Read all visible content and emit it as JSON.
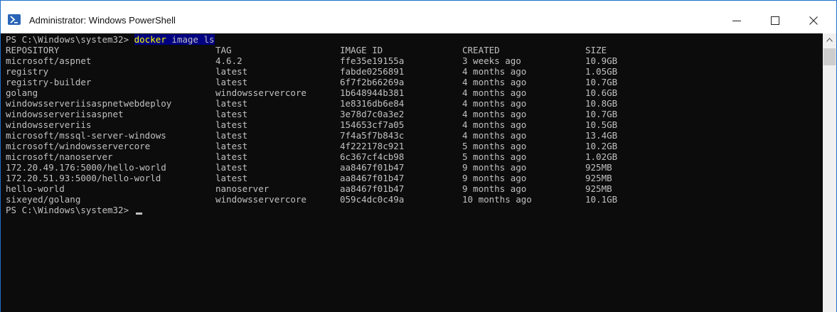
{
  "window": {
    "title": "Administrator: Windows PowerShell"
  },
  "prompt": "PS C:\\Windows\\system32> ",
  "command": {
    "name": "docker",
    "sp1": " ",
    "sub": "image",
    "sp2": " ",
    "arg": "ls"
  },
  "headers": {
    "repository": "REPOSITORY",
    "tag": "TAG",
    "image_id": "IMAGE ID",
    "created": "CREATED",
    "size": "SIZE"
  },
  "rows": [
    {
      "repository": "microsoft/aspnet",
      "tag": "4.6.2",
      "image_id": "ffe35e19155a",
      "created": "3 weeks ago",
      "size": "10.9GB"
    },
    {
      "repository": "registry",
      "tag": "latest",
      "image_id": "fabde0256891",
      "created": "4 months ago",
      "size": "1.05GB"
    },
    {
      "repository": "registry-builder",
      "tag": "latest",
      "image_id": "6f7f2b66269a",
      "created": "4 months ago",
      "size": "10.7GB"
    },
    {
      "repository": "golang",
      "tag": "windowsservercore",
      "image_id": "1b648944b381",
      "created": "4 months ago",
      "size": "10.6GB"
    },
    {
      "repository": "windowsserveriisaspnetwebdeploy",
      "tag": "latest",
      "image_id": "1e8316db6e84",
      "created": "4 months ago",
      "size": "10.8GB"
    },
    {
      "repository": "windowsserveriisaspnet",
      "tag": "latest",
      "image_id": "3e78d7c0a3e2",
      "created": "4 months ago",
      "size": "10.7GB"
    },
    {
      "repository": "windowsserveriis",
      "tag": "latest",
      "image_id": "154653cf7a05",
      "created": "4 months ago",
      "size": "10.5GB"
    },
    {
      "repository": "microsoft/mssql-server-windows",
      "tag": "latest",
      "image_id": "7f4a5f7b843c",
      "created": "4 months ago",
      "size": "13.4GB"
    },
    {
      "repository": "microsoft/windowsservercore",
      "tag": "latest",
      "image_id": "4f222178c921",
      "created": "5 months ago",
      "size": "10.2GB"
    },
    {
      "repository": "microsoft/nanoserver",
      "tag": "latest",
      "image_id": "6c367cf4cb98",
      "created": "5 months ago",
      "size": "1.02GB"
    },
    {
      "repository": "172.20.49.176:5000/hello-world",
      "tag": "latest",
      "image_id": "aa8467f01b47",
      "created": "9 months ago",
      "size": "925MB"
    },
    {
      "repository": "172.20.51.93:5000/hello-world",
      "tag": "latest",
      "image_id": "aa8467f01b47",
      "created": "9 months ago",
      "size": "925MB"
    },
    {
      "repository": "hello-world",
      "tag": "nanoserver",
      "image_id": "aa8467f01b47",
      "created": "9 months ago",
      "size": "925MB"
    },
    {
      "repository": "sixeyed/golang",
      "tag": "windowsservercore",
      "image_id": "059c4dc0c49a",
      "created": "10 months ago",
      "size": "10.1GB"
    }
  ],
  "colors": {
    "console_bg": "#0c0c0c",
    "console_text": "#c0c0c0",
    "selection_bg": "#000080",
    "command_text": "#ffff00"
  }
}
